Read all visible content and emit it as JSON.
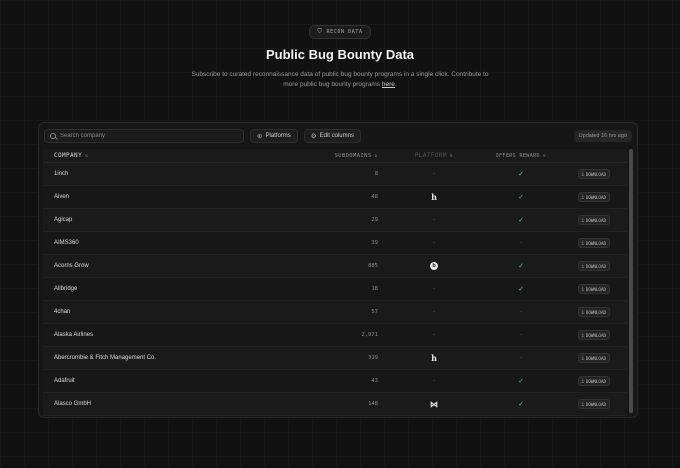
{
  "hero": {
    "badge_icon": "shield-icon",
    "badge": "RECON DATA",
    "title": "Public Bug Bounty Data",
    "subtitle_main": "Subscribe to curated reconnaissance data of public bug bounty programs in a single click. Contribute to more public bug bounty programs ",
    "subtitle_link": "here",
    "subtitle_end": "."
  },
  "toolbar": {
    "search_placeholder": "Search company",
    "platforms_label": "Platforms",
    "edit_columns_label": "Edit columns",
    "updated": "Updated 16 hrs ago"
  },
  "table": {
    "columns": {
      "company": "COMPANY",
      "subdomains": "SUBDOMAINS",
      "platform": "PLATFORM",
      "reward": "OFFERS REWARD"
    },
    "download_label": "DOWNLOAD",
    "rows": [
      {
        "company": "1inch",
        "subdomains": "8",
        "platform": "-",
        "platform_icon": "",
        "reward": "✓"
      },
      {
        "company": "Aiven",
        "subdomains": "48",
        "platform": "",
        "platform_icon": "hackerone-icon",
        "reward": "✓"
      },
      {
        "company": "Agicap",
        "subdomains": "29",
        "platform": "-",
        "platform_icon": "",
        "reward": "✓"
      },
      {
        "company": "AIMS360",
        "subdomains": "39",
        "platform": "-",
        "platform_icon": "",
        "reward": "-"
      },
      {
        "company": "Acorns Grow",
        "subdomains": "885",
        "platform": "",
        "platform_icon": "bugcrowd-icon",
        "reward": "✓"
      },
      {
        "company": "Allbridge",
        "subdomains": "18",
        "platform": "-",
        "platform_icon": "",
        "reward": "✓"
      },
      {
        "company": "4chan",
        "subdomains": "57",
        "platform": "-",
        "platform_icon": "",
        "reward": "-"
      },
      {
        "company": "Alaska Airlines",
        "subdomains": "2,971",
        "platform": "-",
        "platform_icon": "",
        "reward": "-"
      },
      {
        "company": "Abercrombie & Fitch Management Co.",
        "subdomains": "319",
        "platform": "",
        "platform_icon": "hackerone-icon",
        "reward": "-"
      },
      {
        "company": "Adafruit",
        "subdomains": "43",
        "platform": "-",
        "platform_icon": "",
        "reward": "✓"
      },
      {
        "company": "Alasco GmbH",
        "subdomains": "148",
        "platform": "",
        "platform_icon": "intigriti-icon",
        "reward": "✓"
      }
    ]
  },
  "colors": {
    "accent_check": "#5fcf80",
    "background": "#111111"
  }
}
